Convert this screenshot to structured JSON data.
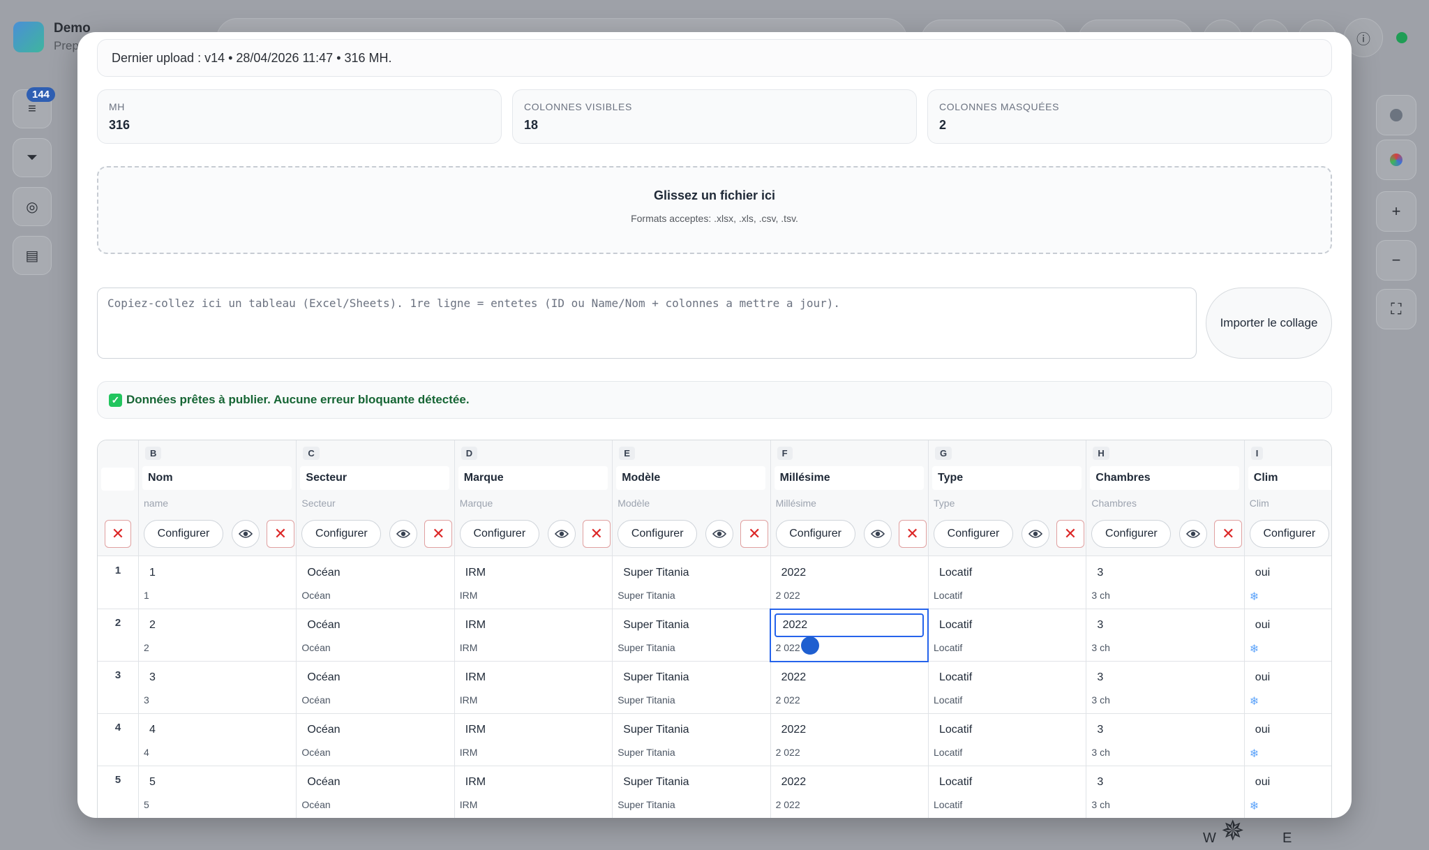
{
  "app": {
    "title": "Demo",
    "subtitle": "Prep",
    "badge_count": "144"
  },
  "upload": {
    "info": "Dernier upload : v14 • 28/04/2026 11:47 • 316 MH."
  },
  "stats": [
    {
      "label": "MH",
      "value": "316"
    },
    {
      "label": "COLONNES VISIBLES",
      "value": "18"
    },
    {
      "label": "COLONNES MASQUÉES",
      "value": "2"
    }
  ],
  "dropzone": {
    "title": "Glissez un fichier ici",
    "formats": "Formats acceptes: .xlsx, .xls, .csv, .tsv."
  },
  "paste": {
    "placeholder": "Copiez-collez ici un tableau (Excel/Sheets). 1re ligne = entetes (ID ou Name/Nom + colonnes a mettre a jour)."
  },
  "import_button": "Importer le collage",
  "status": {
    "message": "Données prêtes à publier. Aucune erreur bloquante détectée."
  },
  "columns": [
    {
      "letter": "B",
      "name": "Nom",
      "key": "name"
    },
    {
      "letter": "C",
      "name": "Secteur",
      "key": "Secteur"
    },
    {
      "letter": "D",
      "name": "Marque",
      "key": "Marque"
    },
    {
      "letter": "E",
      "name": "Modèle",
      "key": "Modèle"
    },
    {
      "letter": "F",
      "name": "Millésime",
      "key": "Millésime"
    },
    {
      "letter": "G",
      "name": "Type",
      "key": "Type"
    },
    {
      "letter": "H",
      "name": "Chambres",
      "key": "Chambres"
    },
    {
      "letter": "I",
      "name": "Clim",
      "key": "Clim"
    }
  ],
  "configure_label": "Configurer",
  "rows": [
    {
      "num": "1",
      "cells": [
        [
          "1",
          "1"
        ],
        [
          "Océan",
          "Océan"
        ],
        [
          "IRM",
          "IRM"
        ],
        [
          "Super Titania",
          "Super Titania"
        ],
        [
          "2022",
          "2 022"
        ],
        [
          "Locatif",
          "Locatif"
        ],
        [
          "3",
          "3 ch"
        ],
        [
          "oui",
          "❄"
        ]
      ]
    },
    {
      "num": "2",
      "cells": [
        [
          "2",
          "2"
        ],
        [
          "Océan",
          "Océan"
        ],
        [
          "IRM",
          "IRM"
        ],
        [
          "Super Titania",
          "Super Titania"
        ],
        [
          "2022",
          "2 022"
        ],
        [
          "Locatif",
          "Locatif"
        ],
        [
          "3",
          "3 ch"
        ],
        [
          "oui",
          "❄"
        ]
      ]
    },
    {
      "num": "3",
      "cells": [
        [
          "3",
          "3"
        ],
        [
          "Océan",
          "Océan"
        ],
        [
          "IRM",
          "IRM"
        ],
        [
          "Super Titania",
          "Super Titania"
        ],
        [
          "2022",
          "2 022"
        ],
        [
          "Locatif",
          "Locatif"
        ],
        [
          "3",
          "3 ch"
        ],
        [
          "oui",
          "❄"
        ]
      ]
    },
    {
      "num": "4",
      "cells": [
        [
          "4",
          "4"
        ],
        [
          "Océan",
          "Océan"
        ],
        [
          "IRM",
          "IRM"
        ],
        [
          "Super Titania",
          "Super Titania"
        ],
        [
          "2022",
          "2 022"
        ],
        [
          "Locatif",
          "Locatif"
        ],
        [
          "3",
          "3 ch"
        ],
        [
          "oui",
          "❄"
        ]
      ]
    },
    {
      "num": "5",
      "cells": [
        [
          "5",
          "5"
        ],
        [
          "Océan",
          "Océan"
        ],
        [
          "IRM",
          "IRM"
        ],
        [
          "Super Titania",
          "Super Titania"
        ],
        [
          "2022",
          "2 022"
        ],
        [
          "Locatif",
          "Locatif"
        ],
        [
          "3",
          "3 ch"
        ],
        [
          "oui",
          "❄"
        ]
      ]
    }
  ],
  "compass": {
    "west": "W",
    "east": "E"
  }
}
